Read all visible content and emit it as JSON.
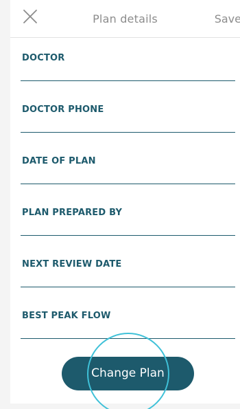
{
  "header": {
    "title": "Plan details",
    "save_label": "Save",
    "close_icon": "close-icon"
  },
  "fields": [
    {
      "label": "DOCTOR",
      "value": ""
    },
    {
      "label": "DOCTOR PHONE",
      "value": ""
    },
    {
      "label": "DATE OF PLAN",
      "value": ""
    },
    {
      "label": "PLAN PREPARED BY",
      "value": ""
    },
    {
      "label": "NEXT REVIEW DATE",
      "value": ""
    },
    {
      "label": "BEST PEAK FLOW",
      "value": ""
    }
  ],
  "actions": {
    "change_plan_label": "Change Plan"
  },
  "colors": {
    "primary": "#1d5a6c",
    "header_text": "#8c8c8c",
    "tap_ring": "#3fc1d8"
  }
}
